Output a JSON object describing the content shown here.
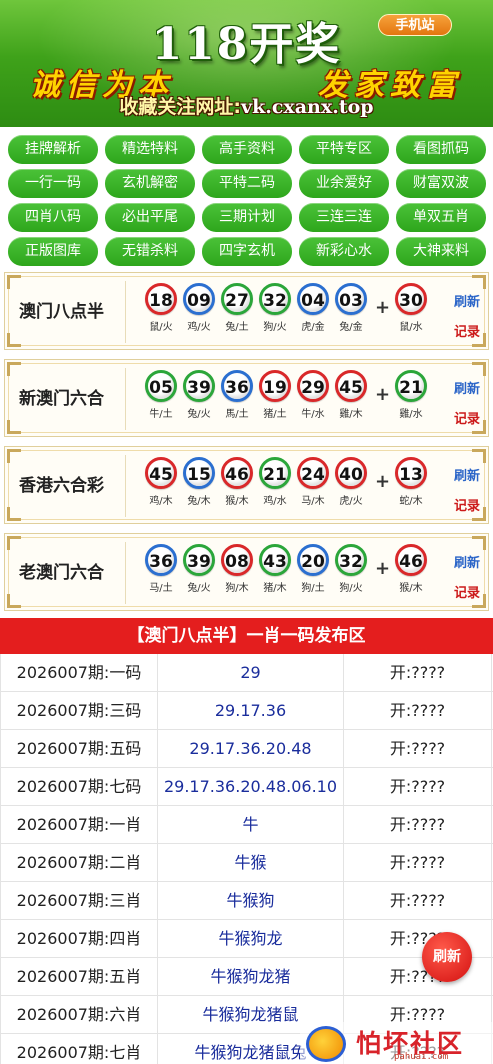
{
  "banner": {
    "title": "118开奖",
    "mobile_badge": "手机站",
    "slogan_left": "诚信为本",
    "slogan_right": "发家致富",
    "site_label": "收藏关注网址:",
    "site_url": "vk.cxanx.top"
  },
  "nav": [
    "挂牌解析",
    "精选特料",
    "高手资料",
    "平特专区",
    "看图抓码",
    "一行一码",
    "玄机解密",
    "平特二码",
    "业余爱好",
    "财富双波",
    "四肖八码",
    "必出平尾",
    "三期计划",
    "三连三连",
    "单双五肖",
    "正版图库",
    "无错杀料",
    "四字玄机",
    "新彩心水",
    "大神来料"
  ],
  "results": [
    {
      "name": "澳门八点半",
      "balls": [
        {
          "num": "18",
          "color": "red",
          "zodiac": "鼠/火"
        },
        {
          "num": "09",
          "color": "blue",
          "zodiac": "鸡/火"
        },
        {
          "num": "27",
          "color": "green",
          "zodiac": "兔/土"
        },
        {
          "num": "32",
          "color": "green",
          "zodiac": "狗/火"
        },
        {
          "num": "04",
          "color": "blue",
          "zodiac": "虎/金"
        },
        {
          "num": "03",
          "color": "blue",
          "zodiac": "兔/金"
        }
      ],
      "special": {
        "num": "30",
        "color": "red",
        "zodiac": "鼠/水"
      },
      "refresh": "刷新",
      "record": "记录"
    },
    {
      "name": "新澳门六合",
      "balls": [
        {
          "num": "05",
          "color": "green",
          "zodiac": "牛/土"
        },
        {
          "num": "39",
          "color": "green",
          "zodiac": "兔/火"
        },
        {
          "num": "36",
          "color": "blue",
          "zodiac": "馬/土"
        },
        {
          "num": "19",
          "color": "red",
          "zodiac": "猪/土"
        },
        {
          "num": "29",
          "color": "red",
          "zodiac": "牛/水"
        },
        {
          "num": "45",
          "color": "red",
          "zodiac": "雞/木"
        }
      ],
      "special": {
        "num": "21",
        "color": "green",
        "zodiac": "雞/水"
      },
      "refresh": "刷新",
      "record": "记录"
    },
    {
      "name": "香港六合彩",
      "balls": [
        {
          "num": "45",
          "color": "red",
          "zodiac": "鸡/木"
        },
        {
          "num": "15",
          "color": "blue",
          "zodiac": "兔/木"
        },
        {
          "num": "46",
          "color": "red",
          "zodiac": "猴/木"
        },
        {
          "num": "21",
          "color": "green",
          "zodiac": "鸡/水"
        },
        {
          "num": "24",
          "color": "red",
          "zodiac": "马/木"
        },
        {
          "num": "40",
          "color": "red",
          "zodiac": "虎/火"
        }
      ],
      "special": {
        "num": "13",
        "color": "red",
        "zodiac": "蛇/木"
      },
      "refresh": "刷新",
      "record": "记录"
    },
    {
      "name": "老澳门六合",
      "balls": [
        {
          "num": "36",
          "color": "blue",
          "zodiac": "马/土"
        },
        {
          "num": "39",
          "color": "green",
          "zodiac": "兔/火"
        },
        {
          "num": "08",
          "color": "red",
          "zodiac": "狗/木"
        },
        {
          "num": "43",
          "color": "green",
          "zodiac": "猪/木"
        },
        {
          "num": "20",
          "color": "blue",
          "zodiac": "狗/土"
        },
        {
          "num": "32",
          "color": "green",
          "zodiac": "狗/火"
        }
      ],
      "special": {
        "num": "46",
        "color": "red",
        "zodiac": "猴/木"
      },
      "refresh": "刷新",
      "record": "记录"
    }
  ],
  "plus_sign": "+",
  "section_title": "【澳门八点半】一肖一码发布区",
  "table_rows": [
    {
      "period": "2026007期:一码",
      "pick": "29",
      "result": "开:????"
    },
    {
      "period": "2026007期:三码",
      "pick": "29.17.36",
      "result": "开:????"
    },
    {
      "period": "2026007期:五码",
      "pick": "29.17.36.20.48",
      "result": "开:????"
    },
    {
      "period": "2026007期:七码",
      "pick": "29.17.36.20.48.06.10",
      "result": "开:????"
    },
    {
      "period": "2026007期:一肖",
      "pick": "牛",
      "result": "开:????"
    },
    {
      "period": "2026007期:二肖",
      "pick": "牛猴",
      "result": "开:????"
    },
    {
      "period": "2026007期:三肖",
      "pick": "牛猴狗",
      "result": "开:????"
    },
    {
      "period": "2026007期:四肖",
      "pick": "牛猴狗龙",
      "result": "开:????"
    },
    {
      "period": "2026007期:五肖",
      "pick": "牛猴狗龙猪",
      "result": "开:????"
    },
    {
      "period": "2026007期:六肖",
      "pick": "牛猴狗龙猪鼠",
      "result": "开:????"
    },
    {
      "period": "2026007期:七肖",
      "pick": "牛猴狗龙猪鼠兔",
      "result": "开:????"
    }
  ],
  "float_button": "刷新",
  "watermark": {
    "text": "怕坏社区",
    "sub": "pahuai.com"
  },
  "colors": {
    "nav_green": "#34ab22",
    "header_red": "#e41e1e",
    "ball_red": "#d9282a",
    "ball_blue": "#2b6fd0",
    "ball_green": "#2ba63a"
  }
}
